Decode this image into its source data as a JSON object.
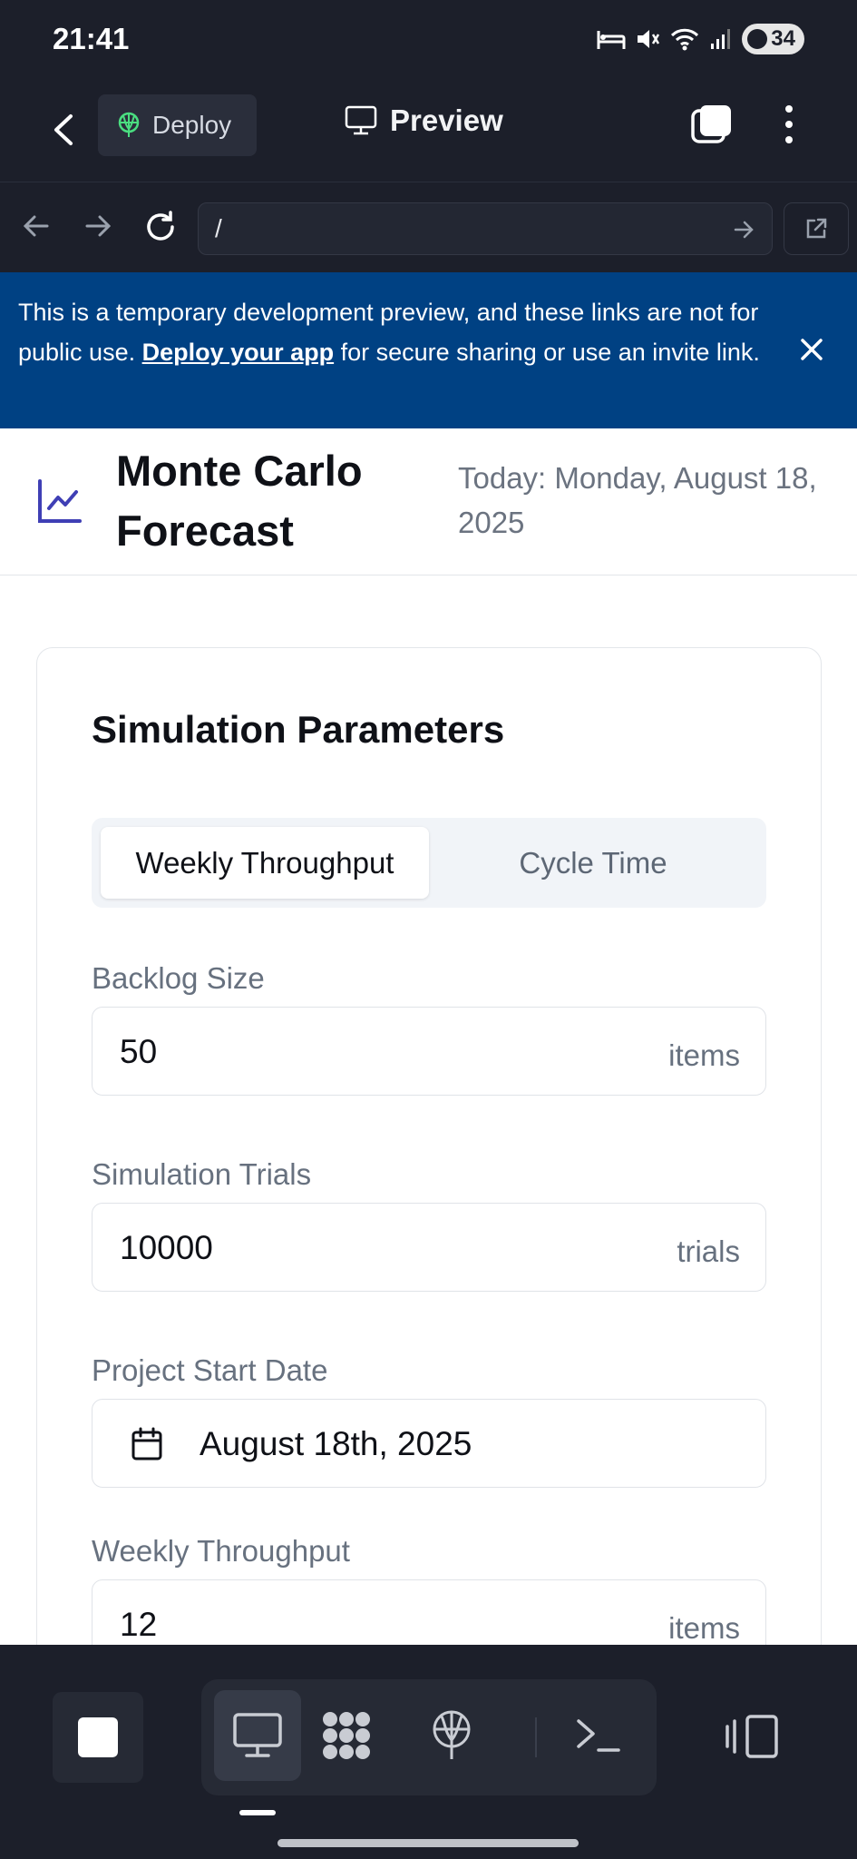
{
  "status_bar": {
    "time": "21:41",
    "battery": "34"
  },
  "app_bar": {
    "deploy_label": "Deploy",
    "title": "Preview"
  },
  "browser": {
    "url": "/"
  },
  "banner": {
    "text_before": "This is a temporary development preview, and these links are not for public use. ",
    "link": "Deploy your app",
    "text_after": " for secure sharing or use an invite link."
  },
  "page": {
    "title": "Monte Carlo Forecast",
    "today": "Today: Monday, August 18, 2025"
  },
  "card": {
    "title": "Simulation Parameters",
    "tabs": [
      {
        "label": "Weekly Throughput",
        "active": true
      },
      {
        "label": "Cycle Time",
        "active": false
      }
    ],
    "fields": {
      "backlog": {
        "label": "Backlog Size",
        "value": "50",
        "unit": "items"
      },
      "trials": {
        "label": "Simulation Trials",
        "value": "10000",
        "unit": "trials"
      },
      "start_date": {
        "label": "Project Start Date",
        "value": "August 18th, 2025"
      },
      "throughput": {
        "label": "Weekly Throughput",
        "value": "12",
        "unit": "items"
      }
    }
  },
  "colors": {
    "app_bg": "#1c1f2a",
    "banner_bg": "#004183",
    "accent": "#3f3fb5",
    "deploy_icon": "#4ade80"
  },
  "icons": {
    "status": [
      "bed-icon",
      "mute-icon",
      "wifi-icon",
      "signal-icon"
    ],
    "toolbar": [
      "stop-icon",
      "monitor-icon",
      "workflow-icon",
      "deploy-icon",
      "terminal-icon",
      "panel-icon"
    ]
  }
}
